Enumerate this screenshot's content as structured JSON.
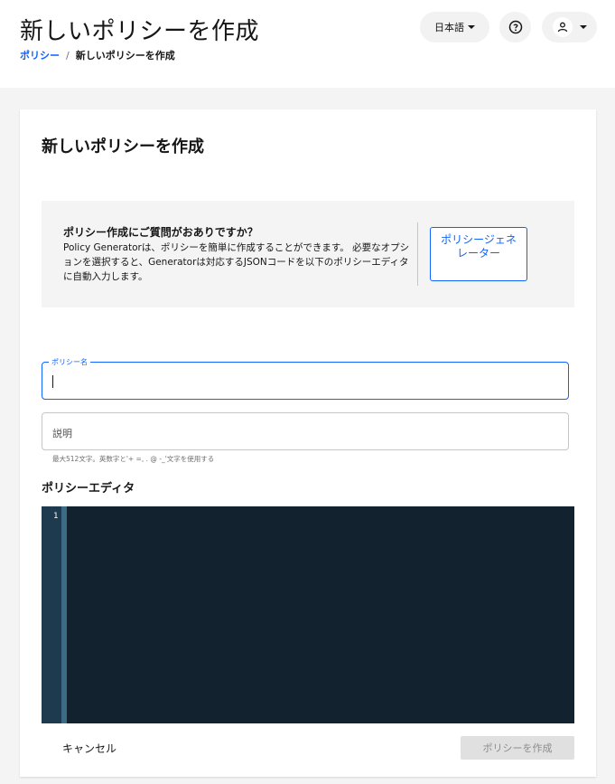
{
  "header": {
    "title": "新しいポリシーを作成",
    "breadcrumb": {
      "parent": "ポリシー",
      "separator": "/",
      "current": "新しいポリシーを作成"
    },
    "language_label": "日本語",
    "help_icon": "help-circle-icon",
    "user_icon": "user-icon"
  },
  "card": {
    "title": "新しいポリシーを作成",
    "info": {
      "heading": "ポリシー作成にご質問がおありですか？",
      "text": "Policy Generatorは、ポリシーを簡単に作成することができます。 必要なオプションを選択すると、Generatorは対応するJSONコードを以下のポリシーエディタに自動入力します。",
      "button_label": "ポリシージェネレーター"
    },
    "policy_name": {
      "label": "ポリシー名",
      "value": ""
    },
    "description": {
      "placeholder": "説明",
      "helper": "最大512文字。英数字と'+ =, . @ -_'文字を使用する"
    },
    "editor": {
      "title": "ポリシーエディタ",
      "line_numbers": [
        "1"
      ]
    },
    "actions": {
      "cancel_label": "キャンセル",
      "create_label": "ポリシーを作成"
    }
  },
  "colors": {
    "accent": "#0f62fe",
    "editor_bg": "#13222f",
    "gutter_bg": "#1e3a4f"
  }
}
